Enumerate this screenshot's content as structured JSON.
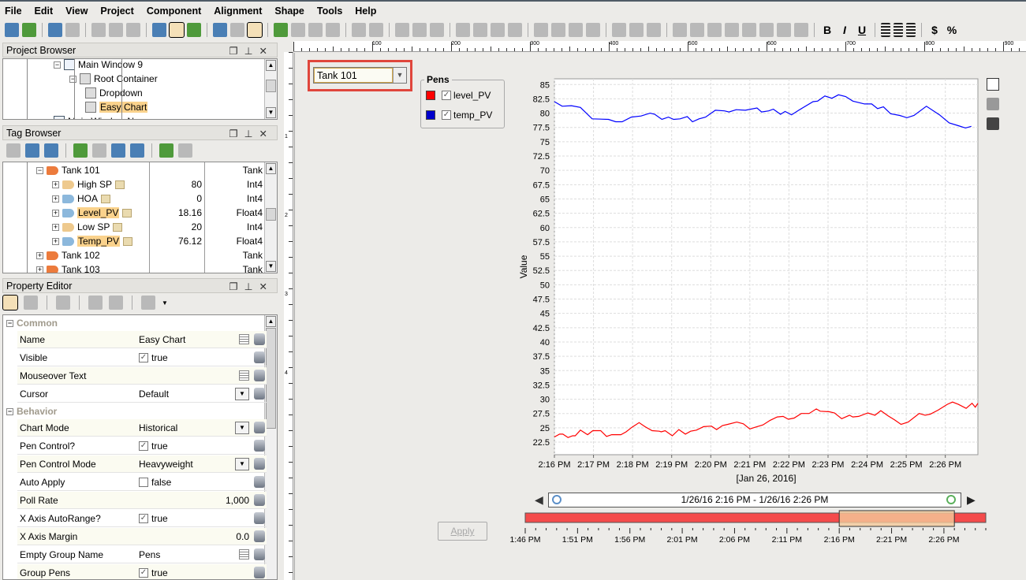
{
  "menu": [
    "File",
    "Edit",
    "View",
    "Project",
    "Component",
    "Alignment",
    "Shape",
    "Tools",
    "Help"
  ],
  "toolbar": {
    "bold": "B",
    "italic": "I",
    "underline": "U",
    "currency": "$",
    "percent": "%"
  },
  "project_browser": {
    "title": "Project Browser",
    "items": [
      {
        "label": "Main Window 9",
        "highlight": false
      },
      {
        "label": "Root Container",
        "highlight": false
      },
      {
        "label": "Dropdown",
        "highlight": false
      },
      {
        "label": "Easy Chart",
        "highlight": true
      },
      {
        "label": "Main Window New",
        "highlight": false
      }
    ]
  },
  "tag_browser": {
    "title": "Tag Browser",
    "rows": [
      {
        "name": "Tank 101",
        "value": "",
        "type": "Tank",
        "level": 0
      },
      {
        "name": "High SP",
        "value": "80",
        "type": "Int4",
        "level": 1
      },
      {
        "name": "HOA",
        "value": "0",
        "type": "Int4",
        "level": 1
      },
      {
        "name": "Level_PV",
        "value": "18.16",
        "type": "Float4",
        "level": 1,
        "highlight": true
      },
      {
        "name": "Low SP",
        "value": "20",
        "type": "Int4",
        "level": 1
      },
      {
        "name": "Temp_PV",
        "value": "76.12",
        "type": "Float4",
        "level": 1,
        "highlight": true
      },
      {
        "name": "Tank 102",
        "value": "",
        "type": "Tank",
        "level": 0
      },
      {
        "name": "Tank 103",
        "value": "",
        "type": "Tank",
        "level": 0
      }
    ]
  },
  "property_editor": {
    "title": "Property Editor",
    "groups": [
      {
        "name": "Common",
        "props": [
          {
            "name": "Name",
            "value": "Easy Chart",
            "kind": "text"
          },
          {
            "name": "Visible",
            "value": "true",
            "kind": "check",
            "checked": true
          },
          {
            "name": "Mouseover Text",
            "value": "",
            "kind": "text"
          },
          {
            "name": "Cursor",
            "value": "Default",
            "kind": "select"
          }
        ]
      },
      {
        "name": "Behavior",
        "props": [
          {
            "name": "Chart Mode",
            "value": "Historical",
            "kind": "select"
          },
          {
            "name": "Pen Control?",
            "value": "true",
            "kind": "check",
            "checked": true
          },
          {
            "name": "Pen Control Mode",
            "value": "Heavyweight",
            "kind": "select"
          },
          {
            "name": "Auto Apply",
            "value": "false",
            "kind": "check",
            "checked": false
          },
          {
            "name": "Poll Rate",
            "value": "1,000",
            "kind": "number"
          },
          {
            "name": "X Axis AutoRange?",
            "value": "true",
            "kind": "check",
            "checked": true
          },
          {
            "name": "X Axis Margin",
            "value": "0.0",
            "kind": "number"
          },
          {
            "name": "Empty Group Name",
            "value": "Pens",
            "kind": "text"
          },
          {
            "name": "Group Pens",
            "value": "true",
            "kind": "check",
            "checked": true
          }
        ]
      }
    ]
  },
  "ruler": {
    "labels": [
      "100",
      "200",
      "300",
      "400",
      "500",
      "600",
      "700",
      "800",
      "900"
    ],
    "left_labels": [
      "1",
      "2",
      "3",
      "4"
    ]
  },
  "designer": {
    "dropdown_value": "Tank 101",
    "apply_label": "Apply",
    "pens": {
      "title": "Pens",
      "items": [
        {
          "name": "level_PV",
          "color": "#ff0000",
          "checked": true
        },
        {
          "name": "temp_PV",
          "color": "#0000cc",
          "checked": true
        }
      ]
    },
    "range_text": "1/26/16 2:16 PM - 1/26/16 2:26 PM",
    "overview": {
      "labels": [
        "1:46 PM",
        "1:51 PM",
        "1:56 PM",
        "2:01 PM",
        "2:06 PM",
        "2:11 PM",
        "2:16 PM",
        "2:21 PM",
        "2:26 PM"
      ],
      "range": [
        "1:46 PM",
        "2:30 PM"
      ],
      "selected": [
        "2:16 PM",
        "2:27 PM"
      ],
      "bar_color": "#f44b4b",
      "selection_color": "#f5c99a"
    }
  },
  "chart_data": {
    "type": "line",
    "ylabel": "Value",
    "xlabel": "[Jan 26, 2016]",
    "ylim": [
      20.3,
      86
    ],
    "xlim": [
      "2:16:00 PM",
      "2:26:50 PM"
    ],
    "grid": true,
    "yticks": [
      "22.5",
      "25",
      "27.5",
      "30",
      "32.5",
      "35",
      "37.5",
      "40",
      "42.5",
      "45",
      "47.5",
      "50",
      "52.5",
      "55",
      "57.5",
      "60",
      "62.5",
      "65",
      "67.5",
      "70",
      "72.5",
      "75",
      "77.5",
      "80",
      "82.5",
      "85"
    ],
    "xticks": [
      "2:16 PM",
      "2:17 PM",
      "2:18 PM",
      "2:19 PM",
      "2:20 PM",
      "2:21 PM",
      "2:22 PM",
      "2:23 PM",
      "2:24 PM",
      "2:25 PM",
      "2:26 PM"
    ],
    "series": [
      {
        "name": "level_PV",
        "color": "#ff0000",
        "points": [
          [
            "2:16:00 PM",
            23.4
          ],
          [
            "2:16:08 PM",
            23.9
          ],
          [
            "2:16:13 PM",
            23.9
          ],
          [
            "2:16:21 PM",
            23.3
          ],
          [
            "2:16:28 PM",
            23.6
          ],
          [
            "2:16:32 PM",
            23.6
          ],
          [
            "2:16:40 PM",
            24.6
          ],
          [
            "2:16:51 PM",
            23.8
          ],
          [
            "2:16:59 PM",
            24.5
          ],
          [
            "2:17:11 PM",
            24.5
          ],
          [
            "2:17:20 PM",
            23.5
          ],
          [
            "2:17:28 PM",
            23.8
          ],
          [
            "2:17:42 PM",
            23.8
          ],
          [
            "2:17:50 PM",
            24.3
          ],
          [
            "2:17:59 PM",
            25.1
          ],
          [
            "2:18:10 PM",
            25.9
          ],
          [
            "2:18:19 PM",
            25.2
          ],
          [
            "2:18:30 PM",
            24.5
          ],
          [
            "2:18:41 PM",
            24.4
          ],
          [
            "2:18:44 PM",
            24.3
          ],
          [
            "2:18:50 PM",
            24.5
          ],
          [
            "2:19:01 PM",
            23.6
          ],
          [
            "2:19:11 PM",
            24.7
          ],
          [
            "2:19:21 PM",
            23.9
          ],
          [
            "2:19:29 PM",
            24.4
          ],
          [
            "2:19:38 PM",
            24.6
          ],
          [
            "2:19:49 PM",
            25.2
          ],
          [
            "2:20:01 PM",
            25.3
          ],
          [
            "2:20:09 PM",
            24.7
          ],
          [
            "2:20:18 PM",
            25.4
          ],
          [
            "2:20:26 PM",
            25.6
          ],
          [
            "2:20:40 PM",
            26.0
          ],
          [
            "2:20:50 PM",
            25.7
          ],
          [
            "2:21:00 PM",
            24.8
          ],
          [
            "2:21:08 PM",
            25.1
          ],
          [
            "2:21:20 PM",
            25.5
          ],
          [
            "2:21:31 PM",
            26.3
          ],
          [
            "2:21:42 PM",
            26.9
          ],
          [
            "2:21:51 PM",
            27.0
          ],
          [
            "2:21:59 PM",
            26.5
          ],
          [
            "2:22:08 PM",
            26.7
          ],
          [
            "2:22:19 PM",
            27.5
          ],
          [
            "2:22:31 PM",
            27.5
          ],
          [
            "2:22:42 PM",
            28.3
          ],
          [
            "2:22:48 PM",
            27.9
          ],
          [
            "2:23:02 PM",
            27.8
          ],
          [
            "2:23:10 PM",
            27.6
          ],
          [
            "2:23:21 PM",
            26.6
          ],
          [
            "2:23:33 PM",
            27.2
          ],
          [
            "2:23:38 PM",
            26.9
          ],
          [
            "2:23:47 PM",
            27.0
          ],
          [
            "2:24:01 PM",
            27.6
          ],
          [
            "2:24:12 PM",
            27.2
          ],
          [
            "2:24:21 PM",
            28.0
          ],
          [
            "2:24:32 PM",
            27.1
          ],
          [
            "2:24:42 PM",
            26.4
          ],
          [
            "2:24:52 PM",
            25.6
          ],
          [
            "2:25:03 PM",
            26.0
          ],
          [
            "2:25:20 PM",
            27.5
          ],
          [
            "2:25:29 PM",
            27.2
          ],
          [
            "2:25:37 PM",
            27.4
          ],
          [
            "2:25:49 PM",
            28.1
          ],
          [
            "2:26:03 PM",
            29.1
          ],
          [
            "2:26:11 PM",
            29.5
          ],
          [
            "2:26:20 PM",
            29.1
          ],
          [
            "2:26:32 PM",
            28.4
          ],
          [
            "2:26:41 PM",
            29.3
          ],
          [
            "2:26:46 PM",
            28.6
          ],
          [
            "2:26:50 PM",
            29.3
          ]
        ]
      },
      {
        "name": "temp_PV",
        "color": "#0000ff",
        "points": [
          [
            "2:16:00 PM",
            82.0
          ],
          [
            "2:16:12 PM",
            81.2
          ],
          [
            "2:16:26 PM",
            81.3
          ],
          [
            "2:16:40 PM",
            81.0
          ],
          [
            "2:16:58 PM",
            79.0
          ],
          [
            "2:17:23 PM",
            78.9
          ],
          [
            "2:17:34 PM",
            78.5
          ],
          [
            "2:17:44 PM",
            78.5
          ],
          [
            "2:17:58 PM",
            79.3
          ],
          [
            "2:18:13 PM",
            79.5
          ],
          [
            "2:18:27 PM",
            80.0
          ],
          [
            "2:18:34 PM",
            79.8
          ],
          [
            "2:18:45 PM",
            78.9
          ],
          [
            "2:18:55 PM",
            79.3
          ],
          [
            "2:19:03 PM",
            78.9
          ],
          [
            "2:19:13 PM",
            79.0
          ],
          [
            "2:19:24 PM",
            79.4
          ],
          [
            "2:19:32 PM",
            78.5
          ],
          [
            "2:19:42 PM",
            79.0
          ],
          [
            "2:19:52 PM",
            79.3
          ],
          [
            "2:20:07 PM",
            80.5
          ],
          [
            "2:20:21 PM",
            80.4
          ],
          [
            "2:20:28 PM",
            80.2
          ],
          [
            "2:20:39 PM",
            80.6
          ],
          [
            "2:20:53 PM",
            80.5
          ],
          [
            "2:21:11 PM",
            80.9
          ],
          [
            "2:21:18 PM",
            80.2
          ],
          [
            "2:21:29 PM",
            80.4
          ],
          [
            "2:21:36 PM",
            80.7
          ],
          [
            "2:21:47 PM",
            79.8
          ],
          [
            "2:21:54 PM",
            80.3
          ],
          [
            "2:22:04 PM",
            79.7
          ],
          [
            "2:22:15 PM",
            80.5
          ],
          [
            "2:22:37 PM",
            82.0
          ],
          [
            "2:22:44 PM",
            82.1
          ],
          [
            "2:22:55 PM",
            83.0
          ],
          [
            "2:23:06 PM",
            82.6
          ],
          [
            "2:23:16 PM",
            83.2
          ],
          [
            "2:23:27 PM",
            82.9
          ],
          [
            "2:23:38 PM",
            82.1
          ],
          [
            "2:23:56 PM",
            81.6
          ],
          [
            "2:24:07 PM",
            81.6
          ],
          [
            "2:24:16 PM",
            80.8
          ],
          [
            "2:24:25 PM",
            81.1
          ],
          [
            "2:24:36 PM",
            79.9
          ],
          [
            "2:24:50 PM",
            79.6
          ],
          [
            "2:25:01 PM",
            79.2
          ],
          [
            "2:25:12 PM",
            79.6
          ],
          [
            "2:25:31 PM",
            81.2
          ],
          [
            "2:25:51 PM",
            79.7
          ],
          [
            "2:26:06 PM",
            78.3
          ],
          [
            "2:26:20 PM",
            77.8
          ],
          [
            "2:26:31 PM",
            77.4
          ],
          [
            "2:26:40 PM",
            77.7
          ]
        ]
      }
    ]
  }
}
